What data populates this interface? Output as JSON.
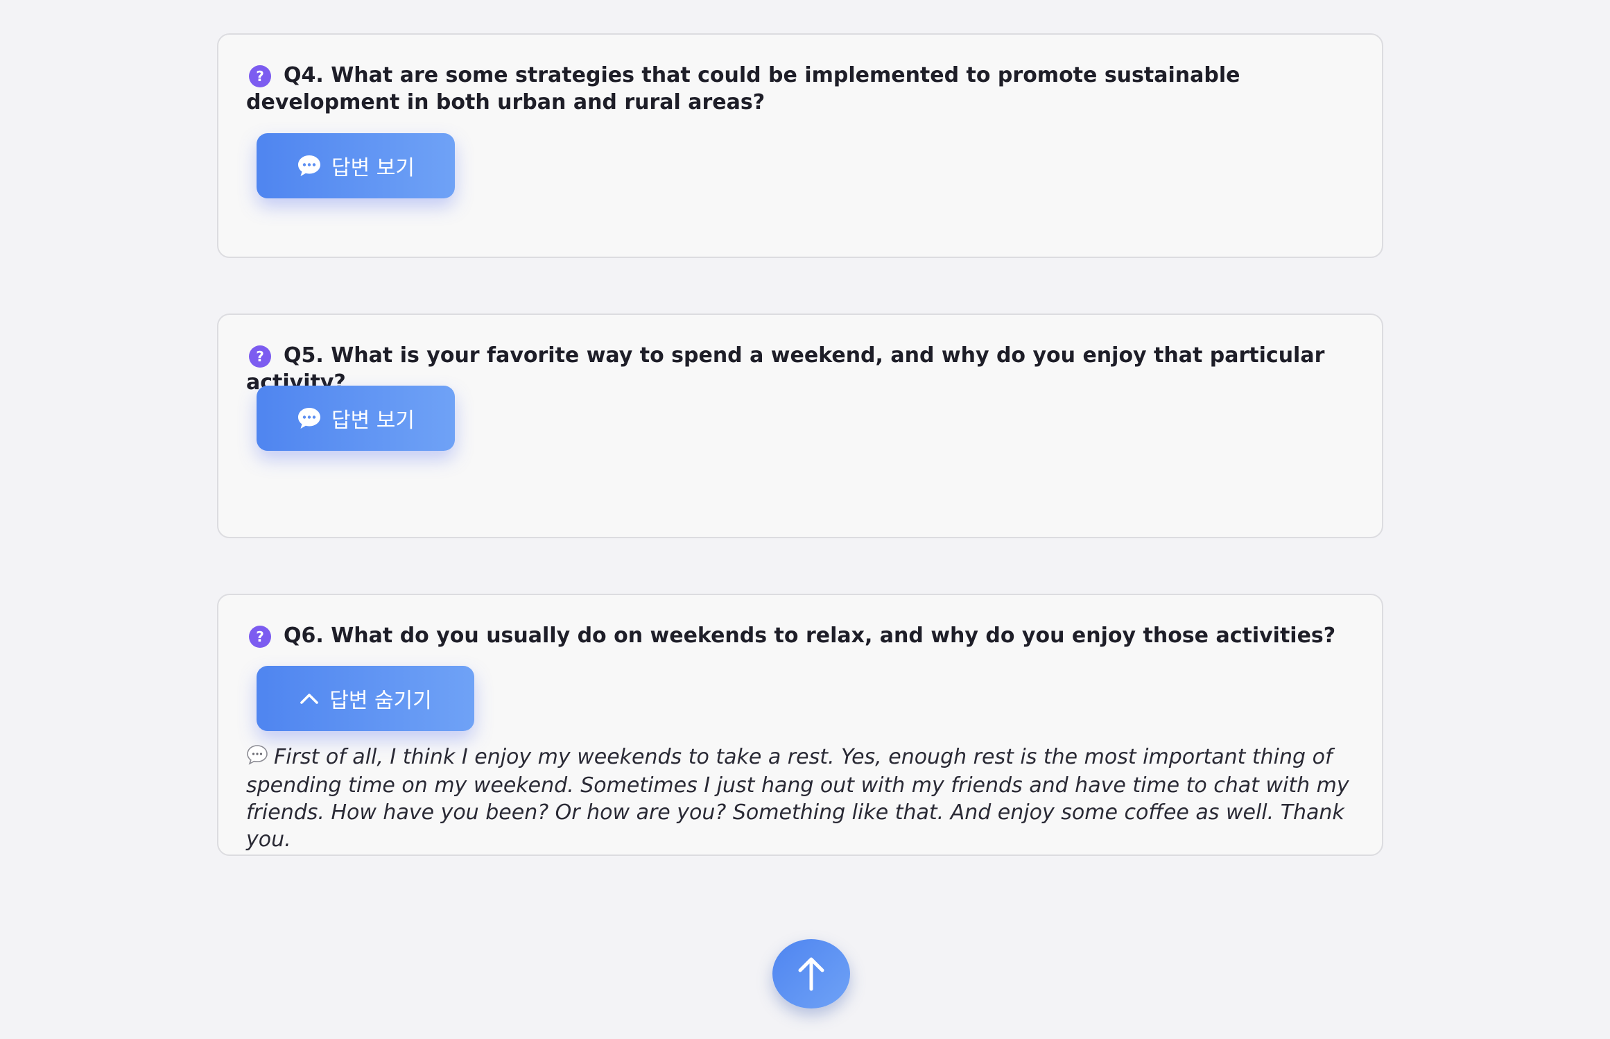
{
  "questions": [
    {
      "id": "Q4",
      "text": "Q4. What are some strategies that could be implemented to promote sustainable development in both urban and rural areas?",
      "button_label": "답변 보기",
      "button_icon": "speech-bubble-icon",
      "expanded": false
    },
    {
      "id": "Q5",
      "text": "Q5. What is your favorite way to spend a weekend, and why do you enjoy that particular activity?",
      "button_label": "답변 보기",
      "button_icon": "speech-bubble-icon",
      "expanded": false
    },
    {
      "id": "Q6",
      "text": "Q6. What do you usually do on weekends to relax, and why do you enjoy those activities?",
      "button_label": "답변 숨기기",
      "button_icon": "chevron-up-icon",
      "expanded": true,
      "answer": "First of all, I think I enjoy my weekends to take a rest. Yes, enough rest is the most important thing of spending time on my weekend. Sometimes I just hang out with my friends and have time to chat with my friends. How have you been? Or how are you? Something like that. And enjoy some coffee as well. Thank you."
    }
  ],
  "question_icon_glyph": "?",
  "scroll_top_icon": "arrow-up-icon",
  "colors": {
    "accent": "#4f85f0",
    "accent_light": "#6fa2f6",
    "question_icon": "#7c5cf0",
    "background": "#f3f3f6",
    "card": "#f8f8f8"
  }
}
